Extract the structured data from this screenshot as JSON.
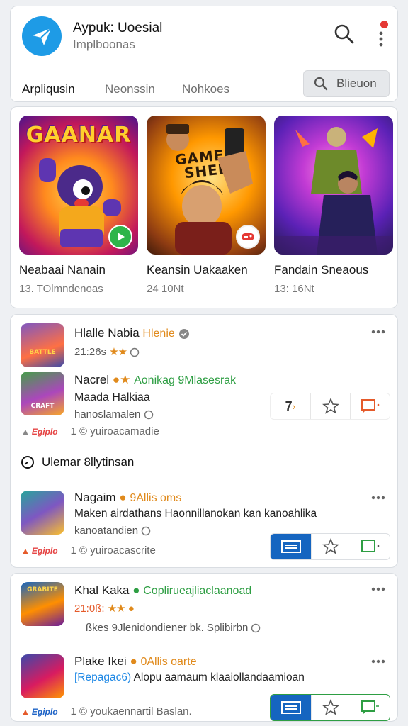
{
  "header": {
    "title": "Aypuk: Uoesial",
    "subtitle": "Implboonas",
    "tabs": [
      {
        "label": "Arpliqusin",
        "active": true
      },
      {
        "label": "Neonssin",
        "active": false
      },
      {
        "label": "Nohkoes",
        "active": false
      }
    ],
    "search_button_label": "Blieuon",
    "icons": {
      "logo": "paper-plane-icon",
      "search": "search-icon",
      "more": "more-vertical-icon"
    },
    "colors": {
      "accent": "#1e88e5",
      "logo_bg": "#1e9be6",
      "notification": "#e53935"
    }
  },
  "featured": [
    {
      "name": "Neabaai Nanain",
      "downloads": "13. TOlmndenoas",
      "art_text": "GAANAR",
      "badge": "play-icon"
    },
    {
      "name": "Keansin Uakaaken",
      "downloads": "24 10Nt",
      "art_text": "GAMER SHEB",
      "badge": "game-controller-icon"
    },
    {
      "name": "Fandain Sneaous",
      "downloads": "13: 16Nt",
      "art_text": "",
      "badge": ""
    }
  ],
  "list1": {
    "items": [
      {
        "title": "Hlalle Nabia",
        "tag": "Hlenie",
        "line": "21:26s",
        "stars": "★★",
        "thumb_text": "BATTLE"
      },
      {
        "title": "Nacrel",
        "tag": "Aonikag 9Mlasesrak",
        "line": "Maada Halkiaa",
        "line2": "hanoslamalen",
        "action_value": "7",
        "meta_brand": "Egiplo",
        "meta_count": "1 © yuiroacamadie",
        "thumb_text": "CRAFT"
      }
    ],
    "section_title": "Ulemar 8llytinsan",
    "section_items": [
      {
        "title": "Nagaim",
        "tag": "9Allis oms",
        "line": "Maken airdathans Haonnillanokan kan kanoahlika",
        "line2": "kanoatandien",
        "meta_brand": "Egiplo",
        "meta_count": "1 © yuiroacascrite"
      }
    ]
  },
  "list2": {
    "items": [
      {
        "title": "Khal Kaka",
        "tag": "Coplirueajliaclaanoad",
        "line": "21:0ß:",
        "stars": "★★",
        "line2": "ßkes 9Jlenidondiener bk. Splibirbn",
        "thumb_text": "GRABITE"
      },
      {
        "title": "Plake Ikei",
        "tag": "0Allis oarte",
        "line_blue": "[Repagac6)",
        "line": "Alopu aamaum klaaiollandaamioan",
        "meta_brand": "Egiplo",
        "meta_count": "1 © youkaennartil Baslan."
      }
    ]
  }
}
